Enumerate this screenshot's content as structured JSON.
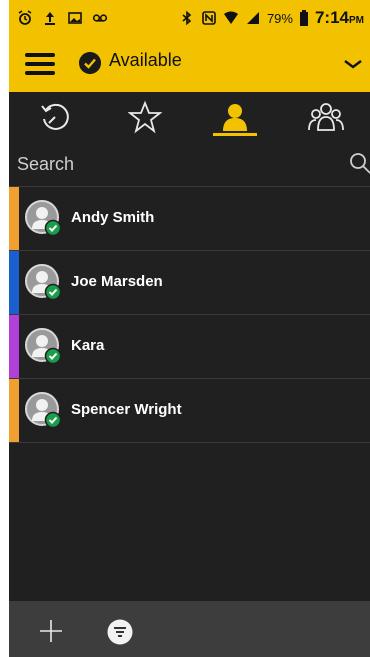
{
  "status_bar": {
    "battery": "79%",
    "time": "7:14",
    "ampm": "PM"
  },
  "app_bar": {
    "presence": "Available"
  },
  "tabs": [
    {
      "name": "recents",
      "icon": "history-icon",
      "active": false
    },
    {
      "name": "favorites",
      "icon": "star-icon",
      "active": false
    },
    {
      "name": "contacts",
      "icon": "person-icon",
      "active": true
    },
    {
      "name": "groups",
      "icon": "group-icon",
      "active": false
    }
  ],
  "search": {
    "placeholder": "Search"
  },
  "contacts": [
    {
      "name": "Andy Smith",
      "accent": "#f0a030"
    },
    {
      "name": "Joe Marsden",
      "accent": "#1a5fd0"
    },
    {
      "name": "Kara",
      "accent": "#b040d8"
    },
    {
      "name": "Spencer Wright",
      "accent": "#f0a030"
    }
  ],
  "colors": {
    "brand_yellow": "#f2c200",
    "presence_green": "#1a9e4a",
    "background": "#202020"
  }
}
